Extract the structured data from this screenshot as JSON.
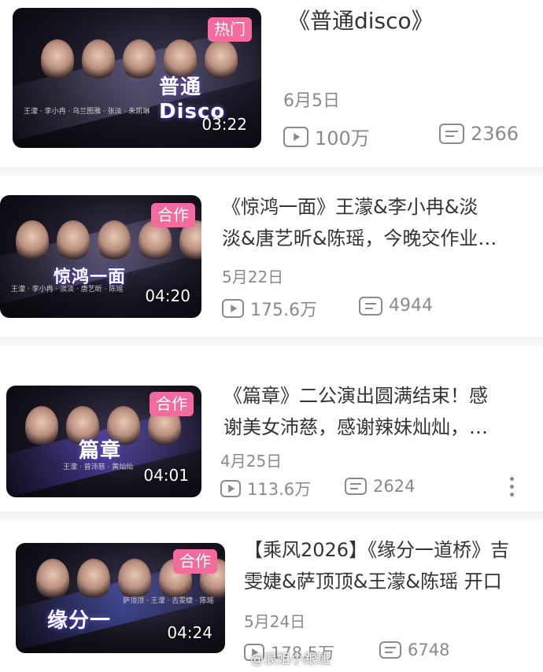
{
  "videos": [
    {
      "title_line1": "《普通disco》",
      "title_line2": "",
      "date": "6月5日",
      "views": "100万",
      "danmaku": "2366",
      "badge": "热门",
      "duration": "03:22",
      "thumb_text": "普通Disco"
    },
    {
      "title_line1": "《惊鸿一面》王濛&李小冉&淡",
      "title_line2": "淡&唐艺昕&陈瑶，今晚交作业…",
      "date": "5月22日",
      "views": "175.6万",
      "danmaku": "4944",
      "badge": "合作",
      "duration": "04:20",
      "thumb_text": "惊鸿一面"
    },
    {
      "title_line1": "《篇章》二公演出圆满结束！感",
      "title_line2": "谢美女沛慈，感谢辣妹灿灿，…",
      "date": "4月25日",
      "views": "113.6万",
      "danmaku": "2624",
      "badge": "合作",
      "duration": "04:01",
      "thumb_text": "篇章"
    },
    {
      "title_line1": "【乘风2026】《缘分一道桥》吉",
      "title_line2": "雯婕&萨顶顶&王濛&陈瑶 开口",
      "date": "5月24日",
      "views": "178.5万",
      "danmaku": "6748",
      "badge": "合作",
      "duration": "04:24",
      "thumb_text": "缘分一"
    }
  ],
  "watermark": "@浪姐小跟班",
  "colors": {
    "badge": "#f36b9c",
    "meta": "#8a8a8a",
    "title": "#333333"
  }
}
